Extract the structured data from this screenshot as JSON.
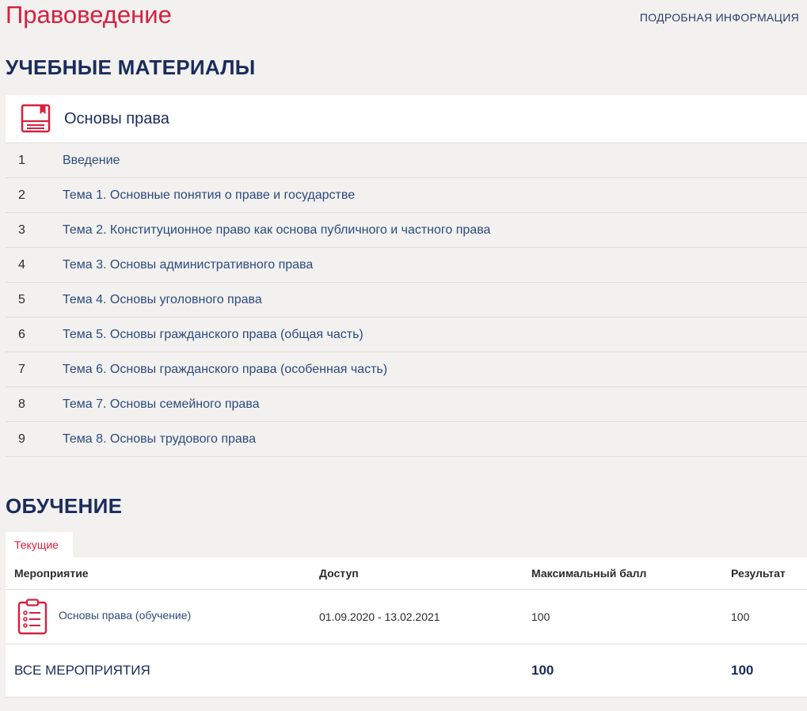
{
  "header": {
    "course_title": "Правоведение",
    "more_info_label": "ПОДРОБНАЯ ИНФОРМАЦИЯ"
  },
  "materials": {
    "section_title": "УЧЕБНЫЕ МАТЕРИАЛЫ",
    "course_name": "Основы права",
    "items": [
      {
        "num": "1",
        "title": "Введение"
      },
      {
        "num": "2",
        "title": "Тема 1. Основные понятия о праве и государстве"
      },
      {
        "num": "3",
        "title": "Тема 2. Конституционное право как основа публичного и частного права"
      },
      {
        "num": "4",
        "title": "Тема 3. Основы административного права"
      },
      {
        "num": "5",
        "title": "Тема 4. Основы уголовного права"
      },
      {
        "num": "6",
        "title": "Тема 5. Основы гражданского права (общая часть)"
      },
      {
        "num": "7",
        "title": "Тема 6. Основы гражданского права (особенная часть)"
      },
      {
        "num": "8",
        "title": "Тема 7. Основы семейного права"
      },
      {
        "num": "9",
        "title": "Тема 8. Основы трудового права"
      }
    ]
  },
  "learning": {
    "section_title": "ОБУЧЕНИЕ",
    "tab_current": "Текущие",
    "columns": {
      "event": "Мероприятие",
      "access": "Доступ",
      "max_score": "Максимальный балл",
      "result": "Результат"
    },
    "rows": [
      {
        "event": "Основы права (обучение)",
        "access": "01.09.2020 - 13.02.2021",
        "max_score": "100",
        "result": "100"
      }
    ],
    "total": {
      "label": "ВСЕ МЕРОПРИЯТИЯ",
      "max_score": "100",
      "result": "100"
    }
  },
  "colors": {
    "accent": "#d6203f",
    "heading": "#1a2c5c",
    "link": "#2d4a7e",
    "background": "#f2f1ef"
  },
  "icons": {
    "materials_header": "book-icon",
    "event_row": "clipboard-list-icon"
  }
}
